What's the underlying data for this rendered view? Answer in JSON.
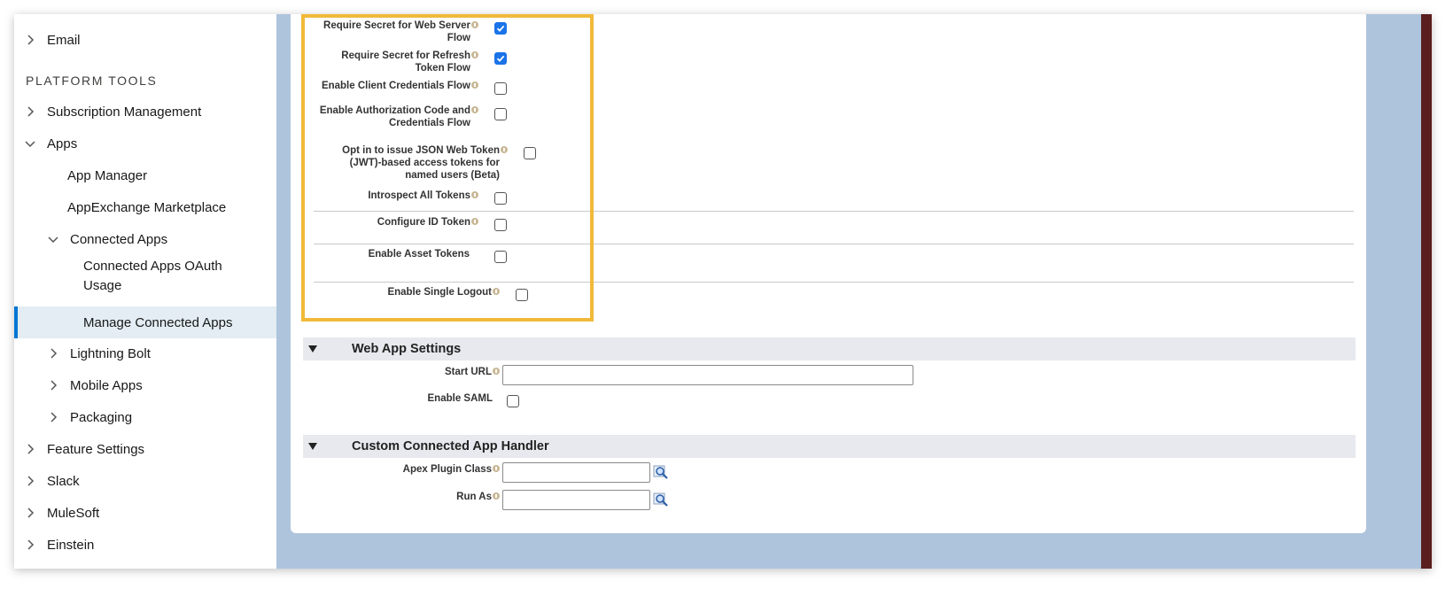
{
  "sidebar": {
    "items": [
      {
        "label": "Email"
      },
      {
        "label": "Subscription Management"
      },
      {
        "label": "Apps"
      },
      {
        "label": "App Manager"
      },
      {
        "label": "AppExchange Marketplace"
      },
      {
        "label": "Connected Apps"
      },
      {
        "label": "Connected Apps OAuth Usage",
        "line1": "Connected Apps OAuth",
        "line2": "Usage"
      },
      {
        "label": "Manage Connected Apps"
      },
      {
        "label": "Lightning Bolt"
      },
      {
        "label": "Mobile Apps"
      },
      {
        "label": "Packaging"
      },
      {
        "label": "Feature Settings"
      },
      {
        "label": "Slack"
      },
      {
        "label": "MuleSoft"
      },
      {
        "label": "Einstein"
      }
    ],
    "section_header": "PLATFORM TOOLS",
    "selected": "Manage Connected Apps",
    "accent_color": "#0176d3"
  },
  "oauth_settings": {
    "require_secret_web_server": {
      "line1": "Require Secret for Web Server",
      "line2": "Flow",
      "checked": true
    },
    "require_secret_refresh": {
      "line1": "Require Secret for Refresh",
      "line2": "Token Flow",
      "checked": true
    },
    "enable_client_credentials": {
      "label": "Enable Client Credentials Flow",
      "checked": false
    },
    "enable_auth_code_credentials": {
      "line1": "Enable Authorization Code and",
      "line2": "Credentials Flow",
      "checked": false
    },
    "jwt_tokens": {
      "line1": "Opt in to issue JSON Web Token",
      "line2": "(JWT)-based access tokens for",
      "line3": "named users (Beta)",
      "checked": false
    },
    "introspect_all_tokens": {
      "label": "Introspect All Tokens",
      "checked": false
    },
    "configure_id_token": {
      "label": "Configure ID Token",
      "checked": false
    },
    "enable_asset_tokens": {
      "label": "Enable Asset Tokens",
      "checked": false
    },
    "enable_single_logout": {
      "label": "Enable Single Logout",
      "checked": false
    },
    "highlight_color": "#f0b93a"
  },
  "web_app_settings": {
    "title": "Web App Settings",
    "start_url_label": "Start URL",
    "start_url_value": "",
    "enable_saml_label": "Enable SAML",
    "enable_saml_checked": false
  },
  "custom_handler": {
    "title": "Custom Connected App Handler",
    "apex_plugin_label": "Apex Plugin Class",
    "apex_plugin_value": "",
    "run_as_label": "Run As",
    "run_as_value": ""
  }
}
